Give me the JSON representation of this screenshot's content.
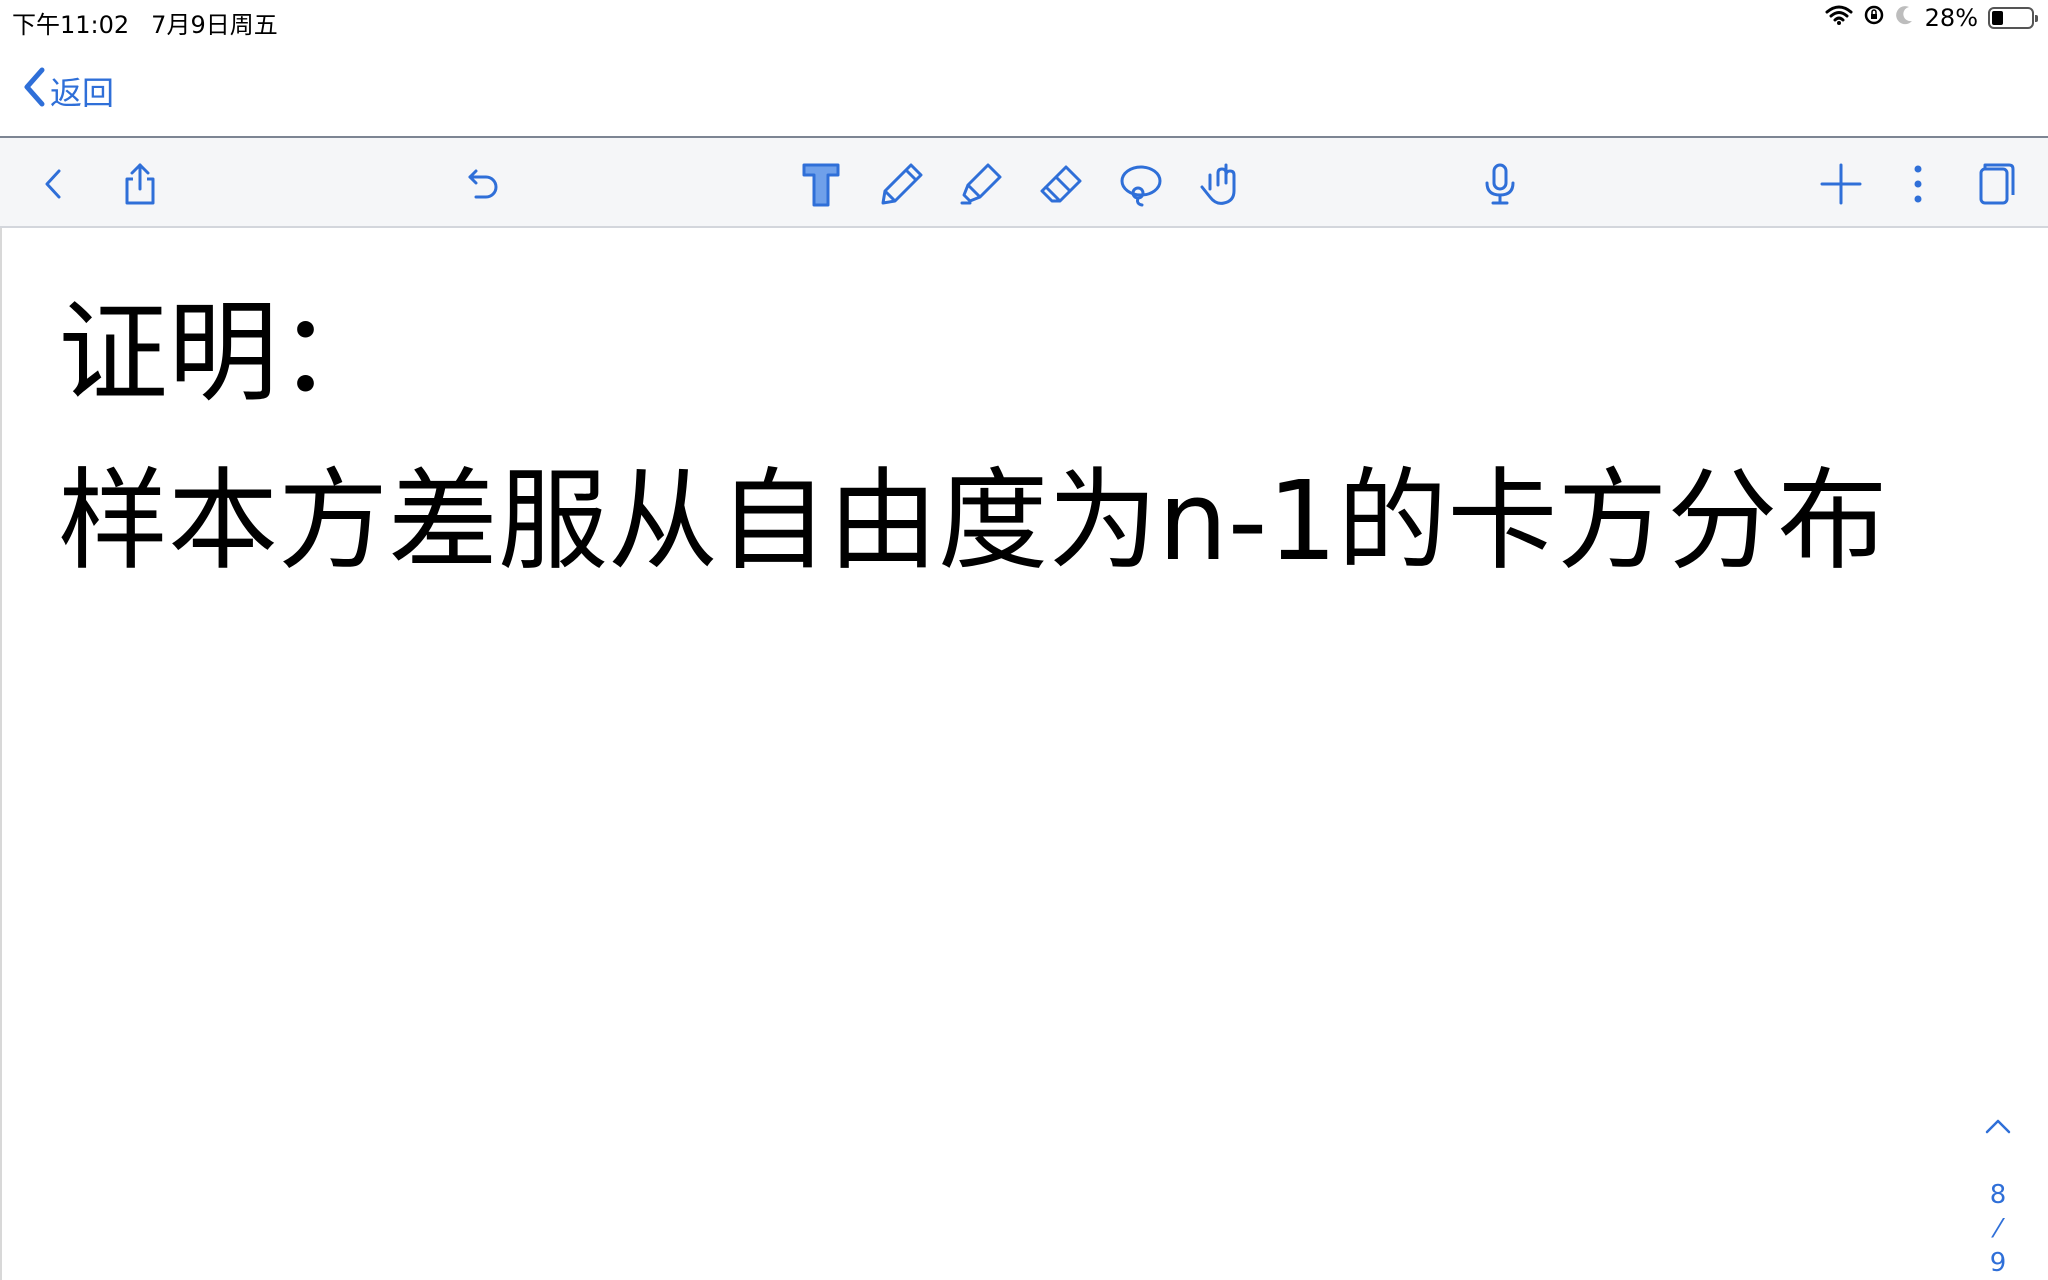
{
  "status": {
    "time": "下午11:02",
    "date": "7月9日周五",
    "battery": "28%",
    "battery_level": 0.28
  },
  "nav": {
    "back_label": "返回"
  },
  "toolbar": {
    "icons": [
      "chevron-left-icon",
      "share-icon",
      "undo-icon",
      "text-tool-icon",
      "pen-icon",
      "highlighter-icon",
      "eraser-icon",
      "lasso-icon",
      "hand-pointer-icon",
      "microphone-icon",
      "plus-icon",
      "more-icon",
      "pages-icon"
    ],
    "accent": "#2f6fd8"
  },
  "note": {
    "line1": "证明：",
    "line2": "样本方差服从自由度为n-1的卡方分布"
  },
  "pager": {
    "current": "8",
    "separator": "⁄",
    "total": "9"
  }
}
